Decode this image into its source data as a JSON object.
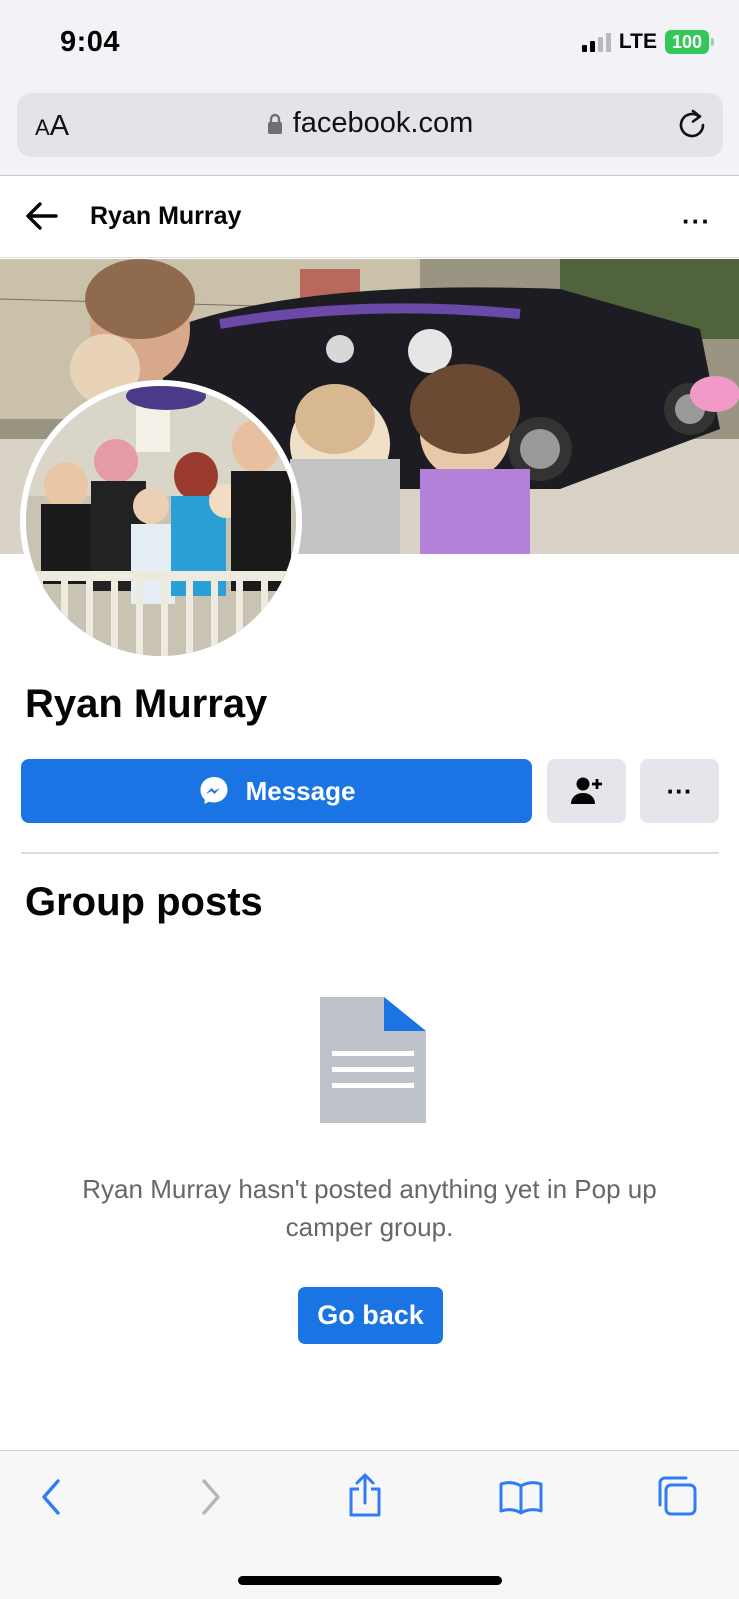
{
  "status_bar": {
    "time": "9:04",
    "network": "LTE",
    "battery": "100",
    "signal_bars_active": 2,
    "signal_bars_total": 4
  },
  "browser": {
    "text_size_label_small": "A",
    "text_size_label_large": "A",
    "url": "facebook.com",
    "lock_icon": "lock-icon",
    "reload_icon": "reload-icon"
  },
  "header": {
    "title": "Ryan Murray",
    "more_label": "···"
  },
  "profile": {
    "name": "Ryan Murray",
    "message_label": "Message",
    "more_label": "···"
  },
  "group_posts": {
    "title": "Group posts",
    "empty_message": "Ryan Murray hasn't posted anything yet in Pop up camper group.",
    "go_back_label": "Go back"
  },
  "colors": {
    "accent": "#1b74e4",
    "battery": "#34c759",
    "secondary_button": "#e4e6eb",
    "muted_text": "#65676b",
    "ios_blue": "#2f7cf6"
  }
}
